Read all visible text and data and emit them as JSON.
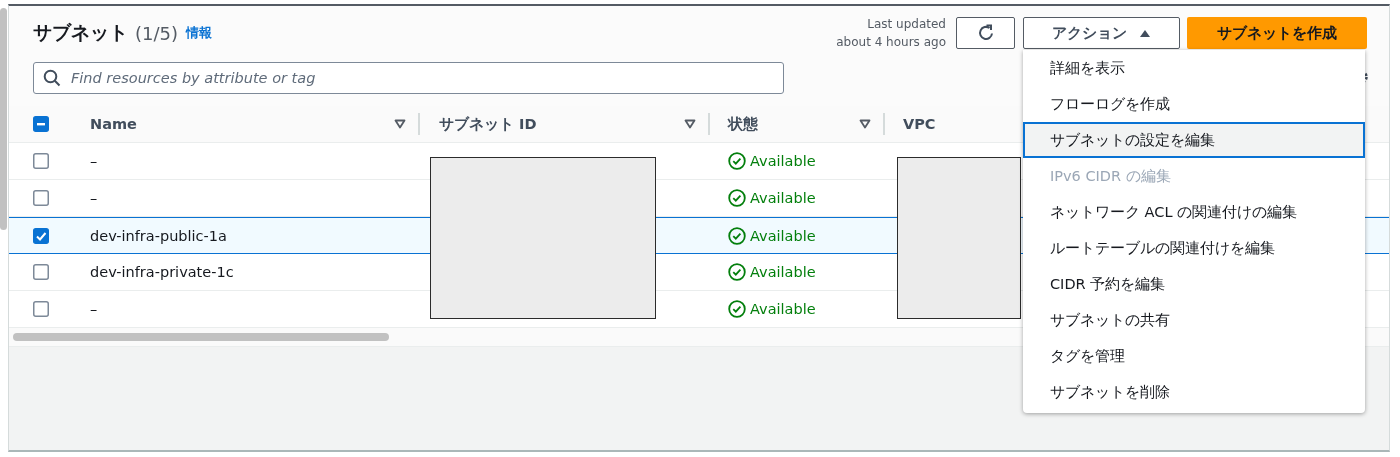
{
  "header": {
    "title": "サブネット",
    "count": "(1/5)",
    "info_link": "情報",
    "last_updated": [
      "Last updated",
      "about 4 hours ago"
    ],
    "actions_button": {
      "label": "アクション",
      "expanded": true
    },
    "create_button": "サブネットを作成"
  },
  "search": {
    "placeholder": "Find resources by attribute or tag"
  },
  "table": {
    "select_all": {
      "partial": true
    },
    "columns": [
      {
        "label": "Name",
        "sortable": true
      },
      {
        "label": "サブネット ID",
        "sortable": true
      },
      {
        "label": "状態",
        "sortable": true
      },
      {
        "label": "VPC",
        "sortable": false
      }
    ],
    "rows": [
      {
        "name": "–",
        "selected": false,
        "status": "Available"
      },
      {
        "name": "–",
        "selected": false,
        "status": "Available"
      },
      {
        "name": "dev-infra-public-1a",
        "selected": true,
        "status": "Available"
      },
      {
        "name": "dev-infra-private-1c",
        "selected": false,
        "status": "Available"
      },
      {
        "name": "–",
        "selected": false,
        "status": "Available"
      }
    ]
  },
  "actions_menu": [
    {
      "label": "詳細を表示",
      "disabled": false,
      "highlighted": false
    },
    {
      "label": "フローログを作成",
      "disabled": false,
      "highlighted": false
    },
    {
      "label": "サブネットの設定を編集",
      "disabled": false,
      "highlighted": true
    },
    {
      "label": "IPv6 CIDR の編集",
      "disabled": true,
      "highlighted": false
    },
    {
      "label": "ネットワーク ACL の関連付けの編集",
      "disabled": false,
      "highlighted": false
    },
    {
      "label": "ルートテーブルの関連付けを編集",
      "disabled": false,
      "highlighted": false
    },
    {
      "label": "CIDR 予約を編集",
      "disabled": false,
      "highlighted": false
    },
    {
      "label": "サブネットの共有",
      "disabled": false,
      "highlighted": false
    },
    {
      "label": "タグを管理",
      "disabled": false,
      "highlighted": false
    },
    {
      "label": "サブネットを削除",
      "disabled": false,
      "highlighted": false
    }
  ]
}
